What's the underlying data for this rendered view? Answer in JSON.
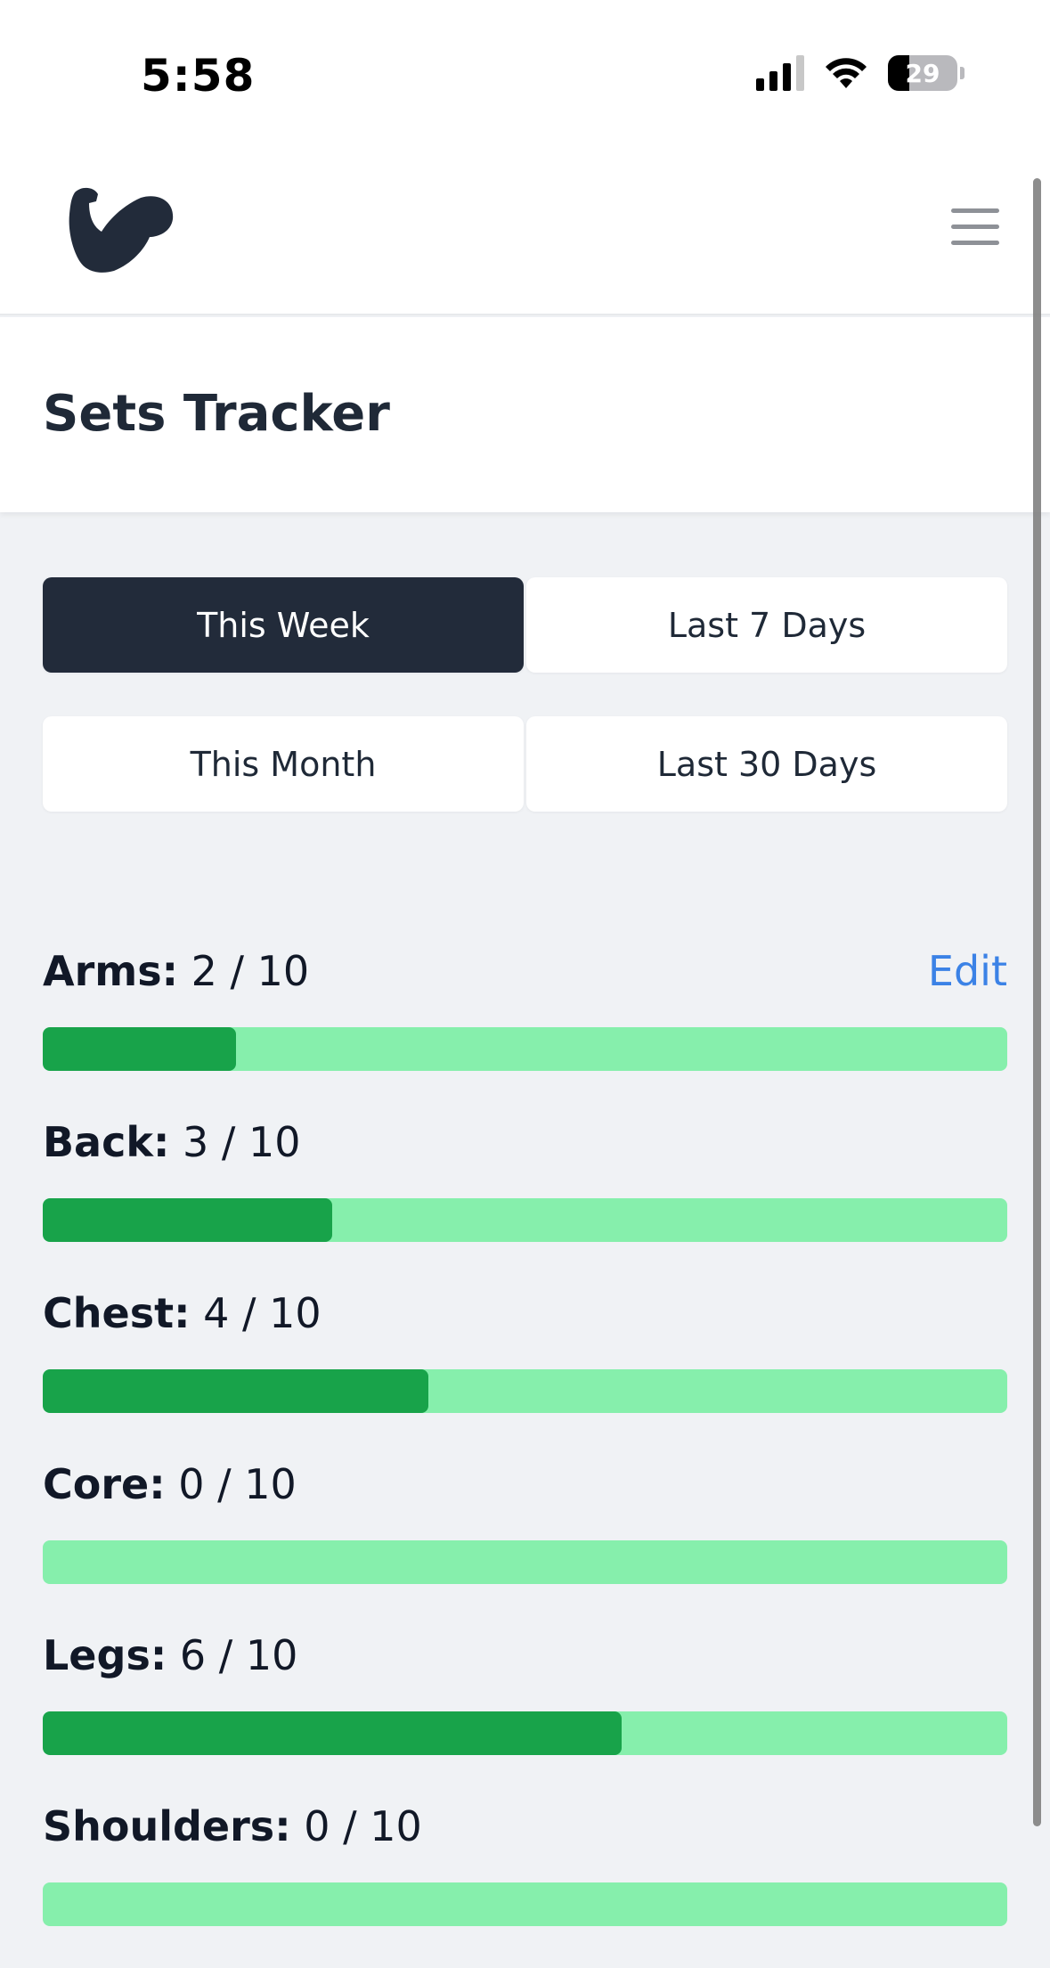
{
  "status_bar": {
    "time": "5:58",
    "battery": "29",
    "icons": [
      "signal-icon",
      "wifi-icon",
      "battery-icon"
    ]
  },
  "header": {
    "logo_icon": "flexed-bicep-icon",
    "menu_icon": "hamburger-menu-icon"
  },
  "page": {
    "title": "Sets Tracker"
  },
  "ranges": [
    {
      "label": "This Week",
      "active": true
    },
    {
      "label": "Last 7 Days",
      "active": false
    },
    {
      "label": "This Month",
      "active": false
    },
    {
      "label": "Last 30 Days",
      "active": false
    }
  ],
  "edit_label": "Edit",
  "muscles": [
    {
      "name": "Arms:",
      "value": "2 / 10",
      "done": 2,
      "target": 10
    },
    {
      "name": "Back:",
      "value": "3 / 10",
      "done": 3,
      "target": 10
    },
    {
      "name": "Chest:",
      "value": "4 / 10",
      "done": 4,
      "target": 10
    },
    {
      "name": "Core:",
      "value": "0 / 10",
      "done": 0,
      "target": 10
    },
    {
      "name": "Legs:",
      "value": "6 / 10",
      "done": 6,
      "target": 10
    },
    {
      "name": "Shoulders:",
      "value": "0 / 10",
      "done": 0,
      "target": 10
    }
  ],
  "colors": {
    "active_tab": "#222b3a",
    "progress_fill": "#18a34a",
    "progress_track": "#86efac",
    "link": "#3b82e6"
  }
}
